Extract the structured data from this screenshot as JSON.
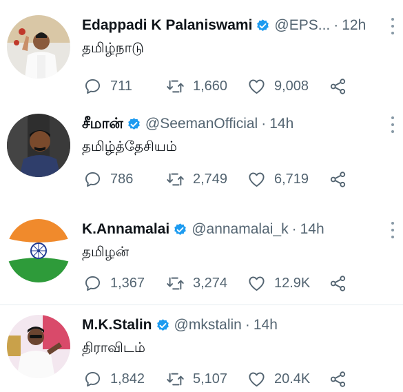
{
  "tweets": [
    {
      "name": "Edappadi K Palaniswami",
      "handle": "@EPS...",
      "dot": "·",
      "time": "12h",
      "text": "தமிழ்நாடு",
      "replies": "711",
      "retweets": "1,660",
      "likes": "9,008"
    },
    {
      "name": "சீமான்",
      "handle": "@SeemanOfficial",
      "dot": "·",
      "time": "14h",
      "text": "தமிழ்த்தேசியம்",
      "replies": "786",
      "retweets": "2,749",
      "likes": "6,719"
    },
    {
      "name": "K.Annamalai",
      "handle": "@annamalai_k",
      "dot": "·",
      "time": "14h",
      "text": "தமிழன்",
      "replies": "1,367",
      "retweets": "3,274",
      "likes": "12.9K"
    },
    {
      "name": "M.K.Stalin",
      "handle": "@mkstalin",
      "dot": "·",
      "time": "14h",
      "text": "திராவிடம்",
      "replies": "1,842",
      "retweets": "5,107",
      "likes": "20.4K"
    }
  ],
  "colors": {
    "verified": "#1d9bf0",
    "secondary_text": "#536471",
    "divider": "#e6ecf0"
  },
  "icons": [
    "verified-badge-icon",
    "more-icon",
    "reply-icon",
    "retweet-icon",
    "like-icon",
    "share-icon"
  ]
}
